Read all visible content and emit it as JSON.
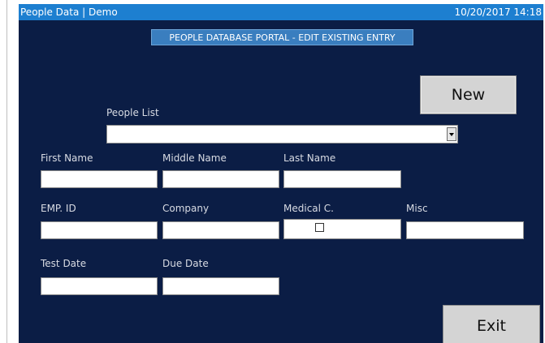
{
  "titlebar": {
    "title": "People Data | Demo",
    "datetime": "10/20/2017 14:18"
  },
  "banner": "PEOPLE DATABASE PORTAL - EDIT EXISTING ENTRY",
  "buttons": {
    "new": "New",
    "exit": "Exit"
  },
  "people_list": {
    "label": "People List",
    "selected": ""
  },
  "fields": {
    "first_name": {
      "label": "First Name",
      "value": ""
    },
    "middle_name": {
      "label": "Middle Name",
      "value": ""
    },
    "last_name": {
      "label": "Last Name",
      "value": ""
    },
    "emp_id": {
      "label": "EMP. ID",
      "value": ""
    },
    "company": {
      "label": "Company",
      "value": ""
    },
    "medical_c": {
      "label": "Medical C.",
      "checked": false
    },
    "misc": {
      "label": "Misc",
      "value": ""
    },
    "test_date": {
      "label": "Test Date",
      "value": ""
    },
    "due_date": {
      "label": "Due Date",
      "value": ""
    }
  },
  "colors": {
    "background": "#0b1d45",
    "titlebar": "#1d7fd0",
    "banner": "#3a7ebf",
    "button": "#d4d4d4"
  }
}
